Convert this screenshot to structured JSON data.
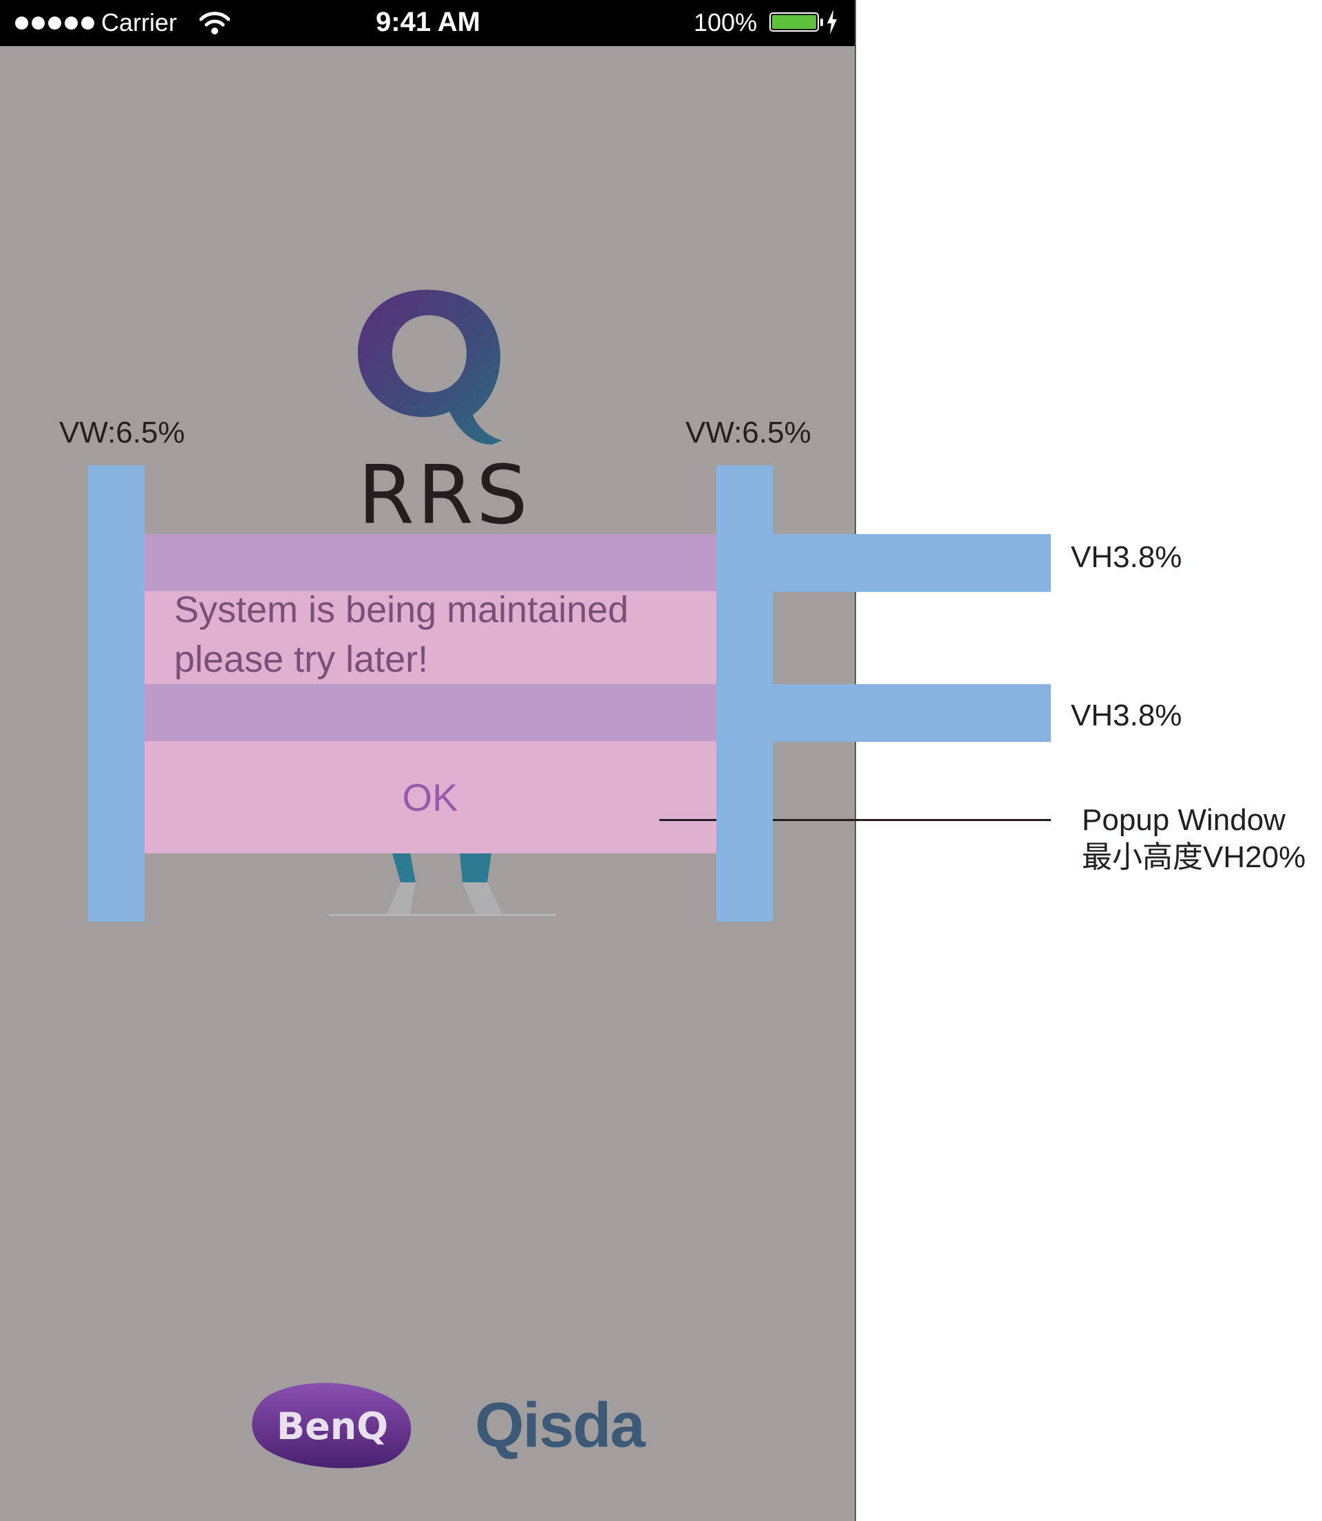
{
  "status_bar": {
    "carrier": "Carrier",
    "time": "9:41 AM",
    "battery": "100%"
  },
  "app": {
    "logo_text": "RRS"
  },
  "popup": {
    "message": "System is being maintained please try later!",
    "ok_label": "OK"
  },
  "annotations": {
    "left_margin": "VW:6.5%",
    "right_margin": "VW:6.5%",
    "top_padding": "VH3.8%",
    "bottom_padding": "VH3.8%",
    "popup_label_line1": "Popup Window",
    "popup_label_line2": "最小高度VH20%"
  },
  "footer": {
    "brand_benq": "BenQ",
    "brand_qisda": "Qisda"
  },
  "colors": {
    "background": "#a29e9e",
    "popup": "#e0b0d1",
    "padding_band": "#bc9bc8",
    "guide": "#89b3e0",
    "ok_text": "#9a5aac",
    "battery": "#5ec13e"
  },
  "icons": [
    "signal-icon",
    "wifi-icon",
    "battery-icon",
    "charging-icon",
    "q-logo-icon",
    "benq-logo",
    "qisda-logo"
  ]
}
